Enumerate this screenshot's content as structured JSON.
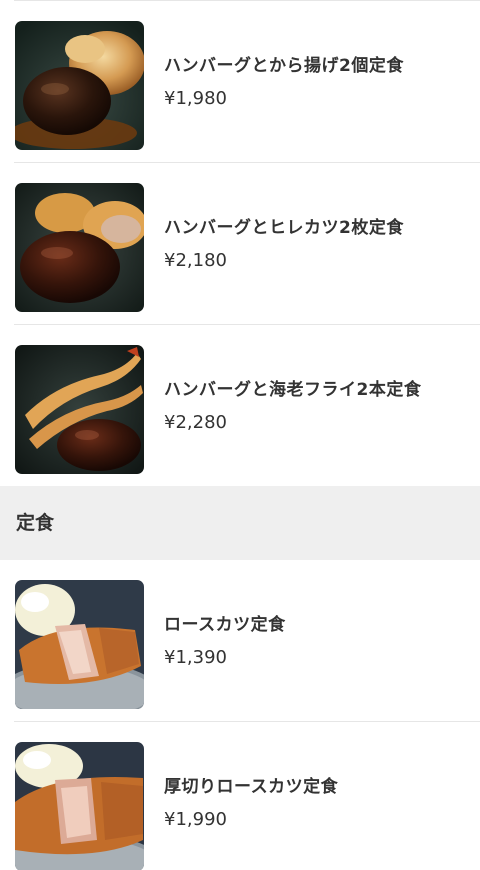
{
  "sections": [
    {
      "items": [
        {
          "name": "ハンバーグとから揚げ2個定食",
          "price": "¥1,980",
          "image": "hamburg-karaage-photo"
        },
        {
          "name": "ハンバーグとヒレカツ2枚定食",
          "price": "¥2,180",
          "image": "hamburg-hirekatsu-photo"
        },
        {
          "name": "ハンバーグと海老フライ2本定食",
          "price": "¥2,280",
          "image": "hamburg-ebifry-photo"
        }
      ]
    },
    {
      "title": "定食",
      "items": [
        {
          "name": "ロースカツ定食",
          "price": "¥1,390",
          "image": "rosukatsu-photo"
        },
        {
          "name": "厚切りロースカツ定食",
          "price": "¥1,990",
          "image": "atsugiri-rosukatsu-photo"
        }
      ]
    }
  ]
}
